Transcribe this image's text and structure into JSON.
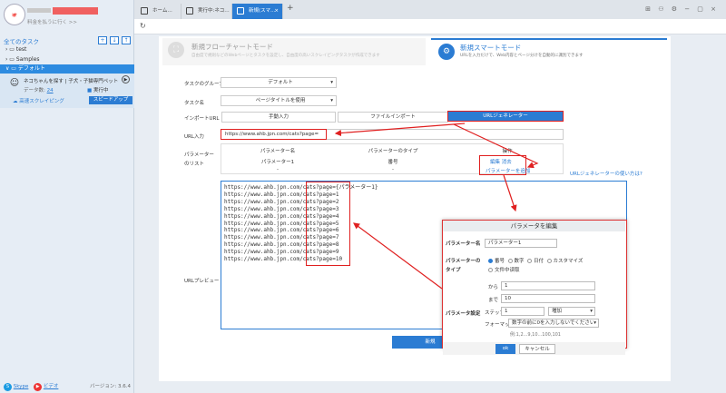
{
  "sidebar": {
    "upgrade": "料金を払うに行く >>",
    "tasks_header": "全てのタスク",
    "tree": [
      "test",
      "Samples",
      "デフォルト"
    ],
    "task": {
      "title": "ネコちゃんを探す | 子犬・子猫専門ペットシ…",
      "data_label": "データ数:",
      "data_count": "24",
      "status": "実行中",
      "local_link": "高速スクレイピング",
      "speed_button": "スピードアップ"
    },
    "skype": "Skype",
    "video": "ビデオ",
    "version": "バージョン: 3.6.4"
  },
  "tabs": [
    "ホーム…",
    "実行中:ネコ…",
    "新規(スマ…",
    "+"
  ],
  "modes": {
    "flow": {
      "title": "新規フローチャートモード",
      "sub": "自由度で規則などのWebページとタスクを設定し、自由度の高いスクレイピングタスクが作成できます"
    },
    "smart": {
      "title": "新規スマートモード",
      "sub": "URLを入力だけで、Web内容とページ分けを自動的に識別できます"
    }
  },
  "form": {
    "group_label": "タスクのグループ",
    "group_value": "デフォルト",
    "name_label": "タスク名",
    "name_value": "ページタイトルを使用",
    "import_label": "インポートURL",
    "import_tabs": [
      "手動入力",
      "ファイルインポート",
      "URLジェネレーター"
    ],
    "url_label": "URL入力",
    "url_value": "https://www.ahb.jpn.com/cats?page=",
    "param_label": "パラメーターのリスト",
    "param_headers": [
      "パラメーター名",
      "パラメーターのタイプ",
      "操作"
    ],
    "param_row": [
      "パラメーター1",
      "番号"
    ],
    "param_row2": [
      "-",
      "-"
    ],
    "edit": "編集",
    "delete": "消去",
    "add": "パラメーターを追加",
    "help": "URLジェネレーターの使い方は?",
    "preview_label": "URLプレビュー",
    "preview_base": "https://www.ahb.jpn.com/cats",
    "preview_params": [
      "?page={パラメーター1}",
      "?page=1",
      "?page=2",
      "?page=3",
      "?page=4",
      "?page=5",
      "?page=6",
      "?page=7",
      "?page=8",
      "?page=9",
      "?page=10"
    ],
    "save": "新規"
  },
  "dialog": {
    "title": "パラメータを編集",
    "name_label": "パラメーター名",
    "name_value": "パラメーター1",
    "type_label": "パラメーターのタイプ",
    "types": [
      "番号",
      "数字",
      "日付",
      "カスタマイズ"
    ],
    "type_extra": "文件中读取",
    "from_label": "から",
    "from_value": "1",
    "to_label": "まで",
    "to_value": "10",
    "setting_label": "パラメータ設定",
    "step_label": "ステップ",
    "step_value": "1",
    "order_value": "増加",
    "format_label": "フォーマット",
    "format_value": "数字の前に0を入力しないでください",
    "example": "例:1,2...9,10...100,101",
    "ok": "ok",
    "cancel": "キャンセル"
  },
  "colors": {
    "accent": "#2b7cd3",
    "highlight": "#e02020"
  }
}
